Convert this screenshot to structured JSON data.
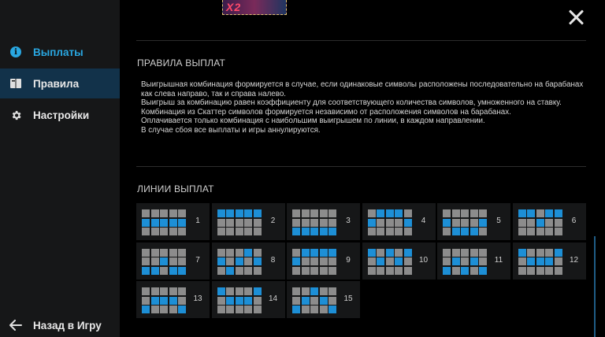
{
  "sidebar": {
    "items": [
      {
        "label": "Выплаты",
        "icon": "info-icon",
        "active": false,
        "highlight": true
      },
      {
        "label": "Правила",
        "icon": "book-icon",
        "active": true,
        "highlight": false
      },
      {
        "label": "Настройки",
        "icon": "gear-icon",
        "active": false,
        "highlight": false
      }
    ],
    "back_label": "Назад в Игру"
  },
  "header": {
    "logo_text": "X2"
  },
  "rules": {
    "title": "ПРАВИЛА ВЫПЛАТ",
    "paragraphs": [
      "Выигрышная комбинация формируется в случае, если одинаковые символы расположены последовательно на барабанах как слева направо, так и справа налево.",
      "Выигрыш за комбинацию равен коэффициенту для соответствующего количества символов, умноженного на ставку.",
      "Комбинация из Скаттер символов формируется независимо от расположения символов на барабанах.",
      "Оплачивается только комбинация с наибольшим выигрышем по линии, в каждом направлении.",
      "В случае сбоя все выплаты и игры аннулируются."
    ]
  },
  "paylines": {
    "title": "ЛИНИИ ВЫПЛАТ",
    "lines": [
      {
        "number": "1",
        "rows": [
          1,
          1,
          1,
          1,
          1
        ]
      },
      {
        "number": "2",
        "rows": [
          0,
          0,
          0,
          0,
          0
        ]
      },
      {
        "number": "3",
        "rows": [
          2,
          2,
          2,
          2,
          2
        ]
      },
      {
        "number": "4",
        "rows": [
          1,
          0,
          0,
          0,
          1
        ]
      },
      {
        "number": "5",
        "rows": [
          1,
          2,
          2,
          2,
          1
        ]
      },
      {
        "number": "6",
        "rows": [
          0,
          0,
          1,
          0,
          0
        ]
      },
      {
        "number": "7",
        "rows": [
          2,
          2,
          1,
          2,
          2
        ]
      },
      {
        "number": "8",
        "rows": [
          1,
          2,
          1,
          0,
          1
        ]
      },
      {
        "number": "9",
        "rows": [
          1,
          0,
          0,
          0,
          0
        ]
      },
      {
        "number": "10",
        "rows": [
          0,
          1,
          0,
          1,
          0
        ]
      },
      {
        "number": "11",
        "rows": [
          2,
          1,
          2,
          1,
          2
        ]
      },
      {
        "number": "12",
        "rows": [
          0,
          1,
          1,
          1,
          0
        ]
      },
      {
        "number": "13",
        "rows": [
          2,
          1,
          1,
          1,
          2
        ]
      },
      {
        "number": "14",
        "rows": [
          0,
          1,
          1,
          1,
          0
        ]
      },
      {
        "number": "15",
        "rows": [
          2,
          1,
          0,
          1,
          2
        ]
      }
    ]
  },
  "colors": {
    "accent": "#29a7e1",
    "active_bg": "#12324a",
    "cell_on": "#1d8fd6",
    "cell_off": "#8c8c8c"
  }
}
